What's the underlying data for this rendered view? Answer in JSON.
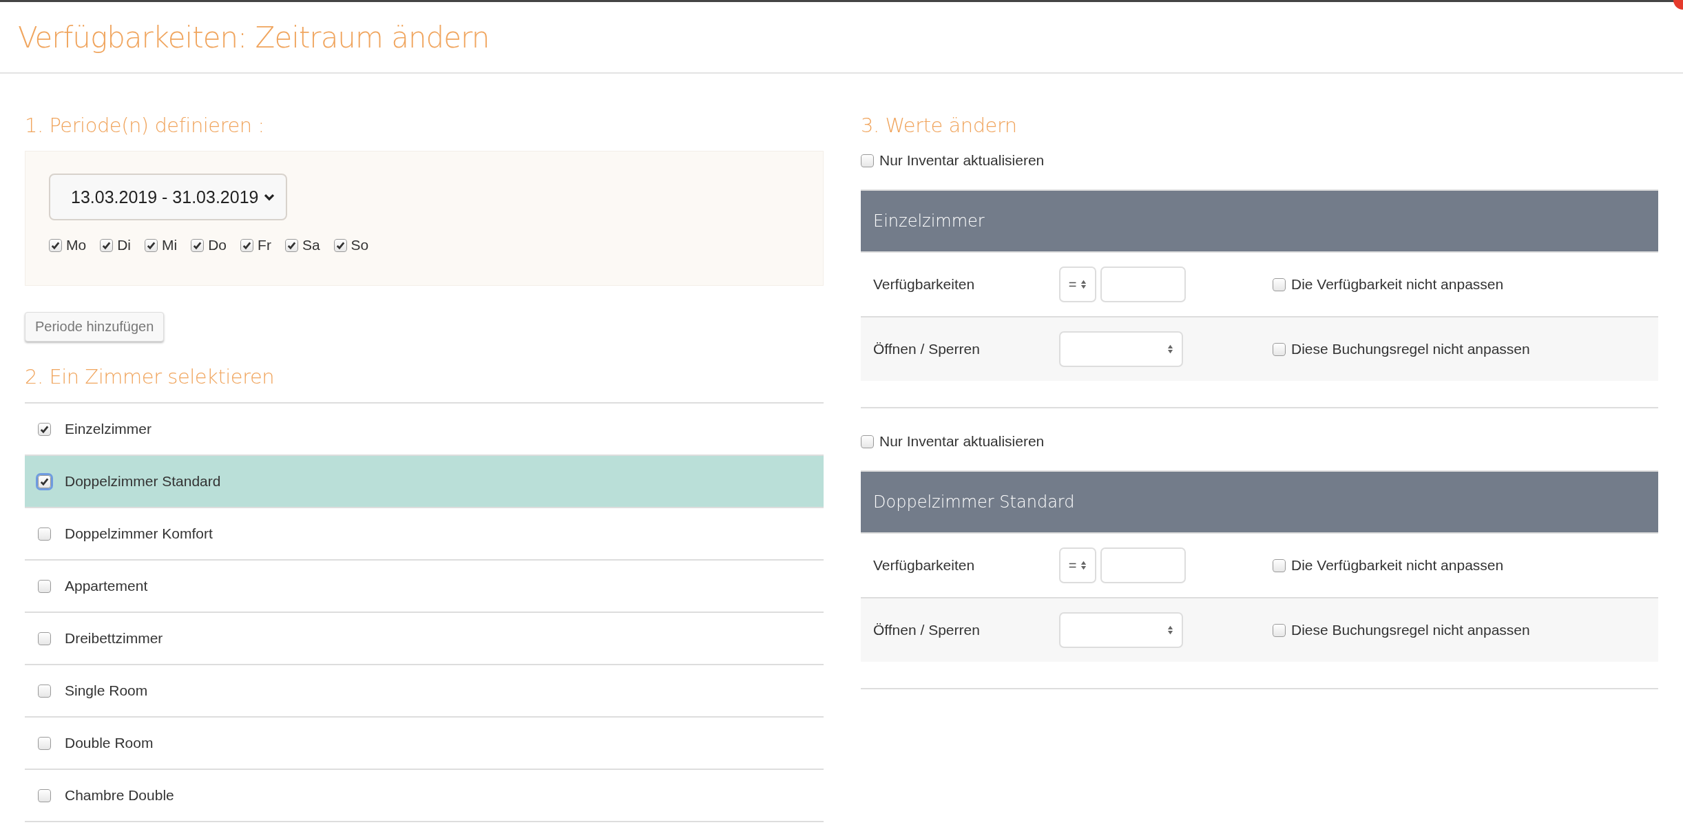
{
  "dialog": {
    "title": "Verfügbarkeiten: Zeitraum ändern"
  },
  "period_section": {
    "heading": "1. Periode(n) definieren :",
    "date_range": "13.03.2019 - 31.03.2019",
    "weekdays": [
      {
        "label": "Mo",
        "checked": true
      },
      {
        "label": "Di",
        "checked": true
      },
      {
        "label": "Mi",
        "checked": true
      },
      {
        "label": "Do",
        "checked": true
      },
      {
        "label": "Fr",
        "checked": true
      },
      {
        "label": "Sa",
        "checked": true
      },
      {
        "label": "So",
        "checked": true
      }
    ],
    "add_button": "Periode hinzufügen"
  },
  "room_section": {
    "heading": "2. Ein Zimmer selektieren",
    "rooms": [
      {
        "name": "Einzelzimmer",
        "checked": true,
        "selected": false
      },
      {
        "name": "Doppelzimmer Standard",
        "checked": true,
        "selected": true
      },
      {
        "name": "Doppelzimmer Komfort",
        "checked": false,
        "selected": false
      },
      {
        "name": "Appartement",
        "checked": false,
        "selected": false
      },
      {
        "name": "Dreibettzimmer",
        "checked": false,
        "selected": false
      },
      {
        "name": "Single Room",
        "checked": false,
        "selected": false
      },
      {
        "name": "Double Room",
        "checked": false,
        "selected": false
      },
      {
        "name": "Chambre Double",
        "checked": false,
        "selected": false
      }
    ]
  },
  "values_section": {
    "heading": "3. Werte ändern",
    "rooms": [
      {
        "inventory_only": {
          "label": "Nur Inventar aktualisieren",
          "checked": false
        },
        "title": "Einzelzimmer",
        "rows": [
          {
            "kind": "number",
            "label": "Verfügbarkeiten",
            "operator": "=",
            "skip": {
              "label": "Die Verfügbarkeit nicht anpassen",
              "checked": false
            }
          },
          {
            "kind": "select",
            "label": "Öffnen / Sperren",
            "skip": {
              "label": "Diese Buchungsregel nicht anpassen",
              "checked": false
            }
          }
        ]
      },
      {
        "inventory_only": {
          "label": "Nur Inventar aktualisieren",
          "checked": false
        },
        "title": "Doppelzimmer Standard",
        "rows": [
          {
            "kind": "number",
            "label": "Verfügbarkeiten",
            "operator": "=",
            "skip": {
              "label": "Die Verfügbarkeit nicht anpassen",
              "checked": false
            }
          },
          {
            "kind": "select",
            "label": "Öffnen / Sperren",
            "skip": {
              "label": "Diese Buchungsregel nicht anpassen",
              "checked": false
            }
          }
        ]
      }
    ]
  }
}
